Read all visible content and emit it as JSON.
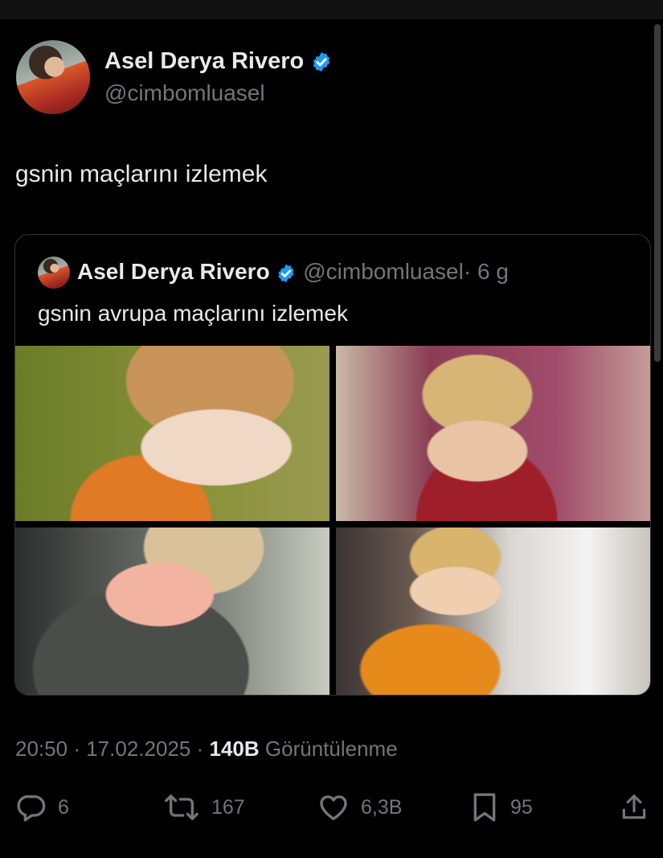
{
  "author": {
    "name": "Asel Derya Rivero",
    "handle": "@cimbomluasel",
    "verified": true
  },
  "tweet": {
    "text": "gsnin maçlarını izlemek"
  },
  "quoted_tweet": {
    "name": "Asel Derya Rivero",
    "handle": "@cimbomluasel",
    "separator": "·",
    "time_ago": "6 g",
    "text": "gsnin avrupa maçlarını izlemek",
    "images": [
      "image-1",
      "image-2",
      "image-3",
      "image-4"
    ]
  },
  "meta": {
    "time": "20:50",
    "sep1": "·",
    "date": "17.02.2025",
    "sep2": "·",
    "views_count": "140B",
    "views_label": "Görüntülenme"
  },
  "actions": {
    "replies": "6",
    "reposts": "167",
    "likes": "6,3B",
    "bookmarks": "95"
  },
  "colors": {
    "background": "#000000",
    "text_primary": "#e7e9ea",
    "text_secondary": "#71767b",
    "verified_blue": "#1d9bf0",
    "border": "#2f3336"
  },
  "icons": [
    "verified-badge-icon",
    "reply-icon",
    "repost-icon",
    "like-icon",
    "bookmark-icon",
    "share-icon"
  ]
}
